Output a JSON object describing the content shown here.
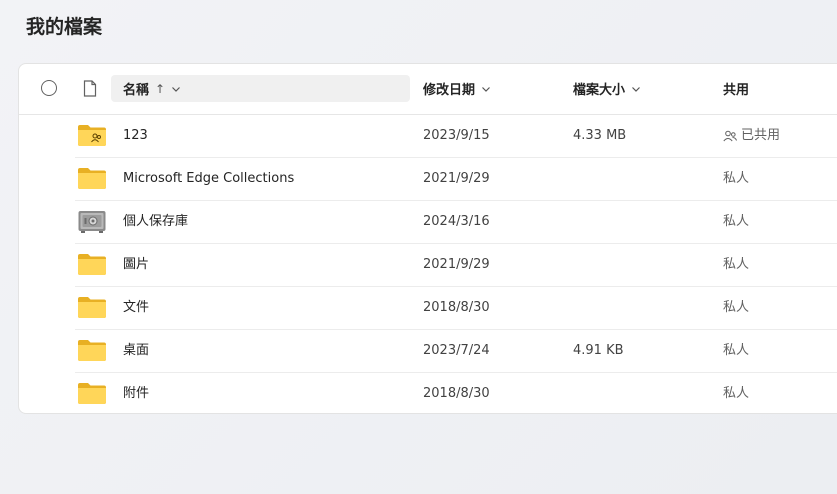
{
  "page": {
    "title": "我的檔案"
  },
  "columns": {
    "name": "名稱",
    "sort_arrow": "↑",
    "modified": "修改日期",
    "size": "檔案大小",
    "shared": "共用"
  },
  "rows": [
    {
      "icon": "shared-folder-icon",
      "name": "123",
      "modified": "2023/9/15",
      "size": "4.33 MB",
      "shared": "已共用"
    },
    {
      "icon": "folder-icon",
      "name": "Microsoft Edge Collections",
      "modified": "2021/9/29",
      "size": "",
      "shared": "私人"
    },
    {
      "icon": "vault-icon",
      "name": "個人保存庫",
      "modified": "2024/3/16",
      "size": "",
      "shared": "私人"
    },
    {
      "icon": "folder-icon",
      "name": "圖片",
      "modified": "2021/9/29",
      "size": "",
      "shared": "私人"
    },
    {
      "icon": "folder-icon",
      "name": "文件",
      "modified": "2018/8/30",
      "size": "",
      "shared": "私人"
    },
    {
      "icon": "folder-icon",
      "name": "桌面",
      "modified": "2023/7/24",
      "size": "4.91 KB",
      "shared": "私人"
    },
    {
      "icon": "folder-icon",
      "name": "附件",
      "modified": "2018/8/30",
      "size": "",
      "shared": "私人"
    }
  ],
  "colors": {
    "folder": "#f8c938",
    "folder_light": "#ffd96a",
    "accent": "#242424"
  }
}
